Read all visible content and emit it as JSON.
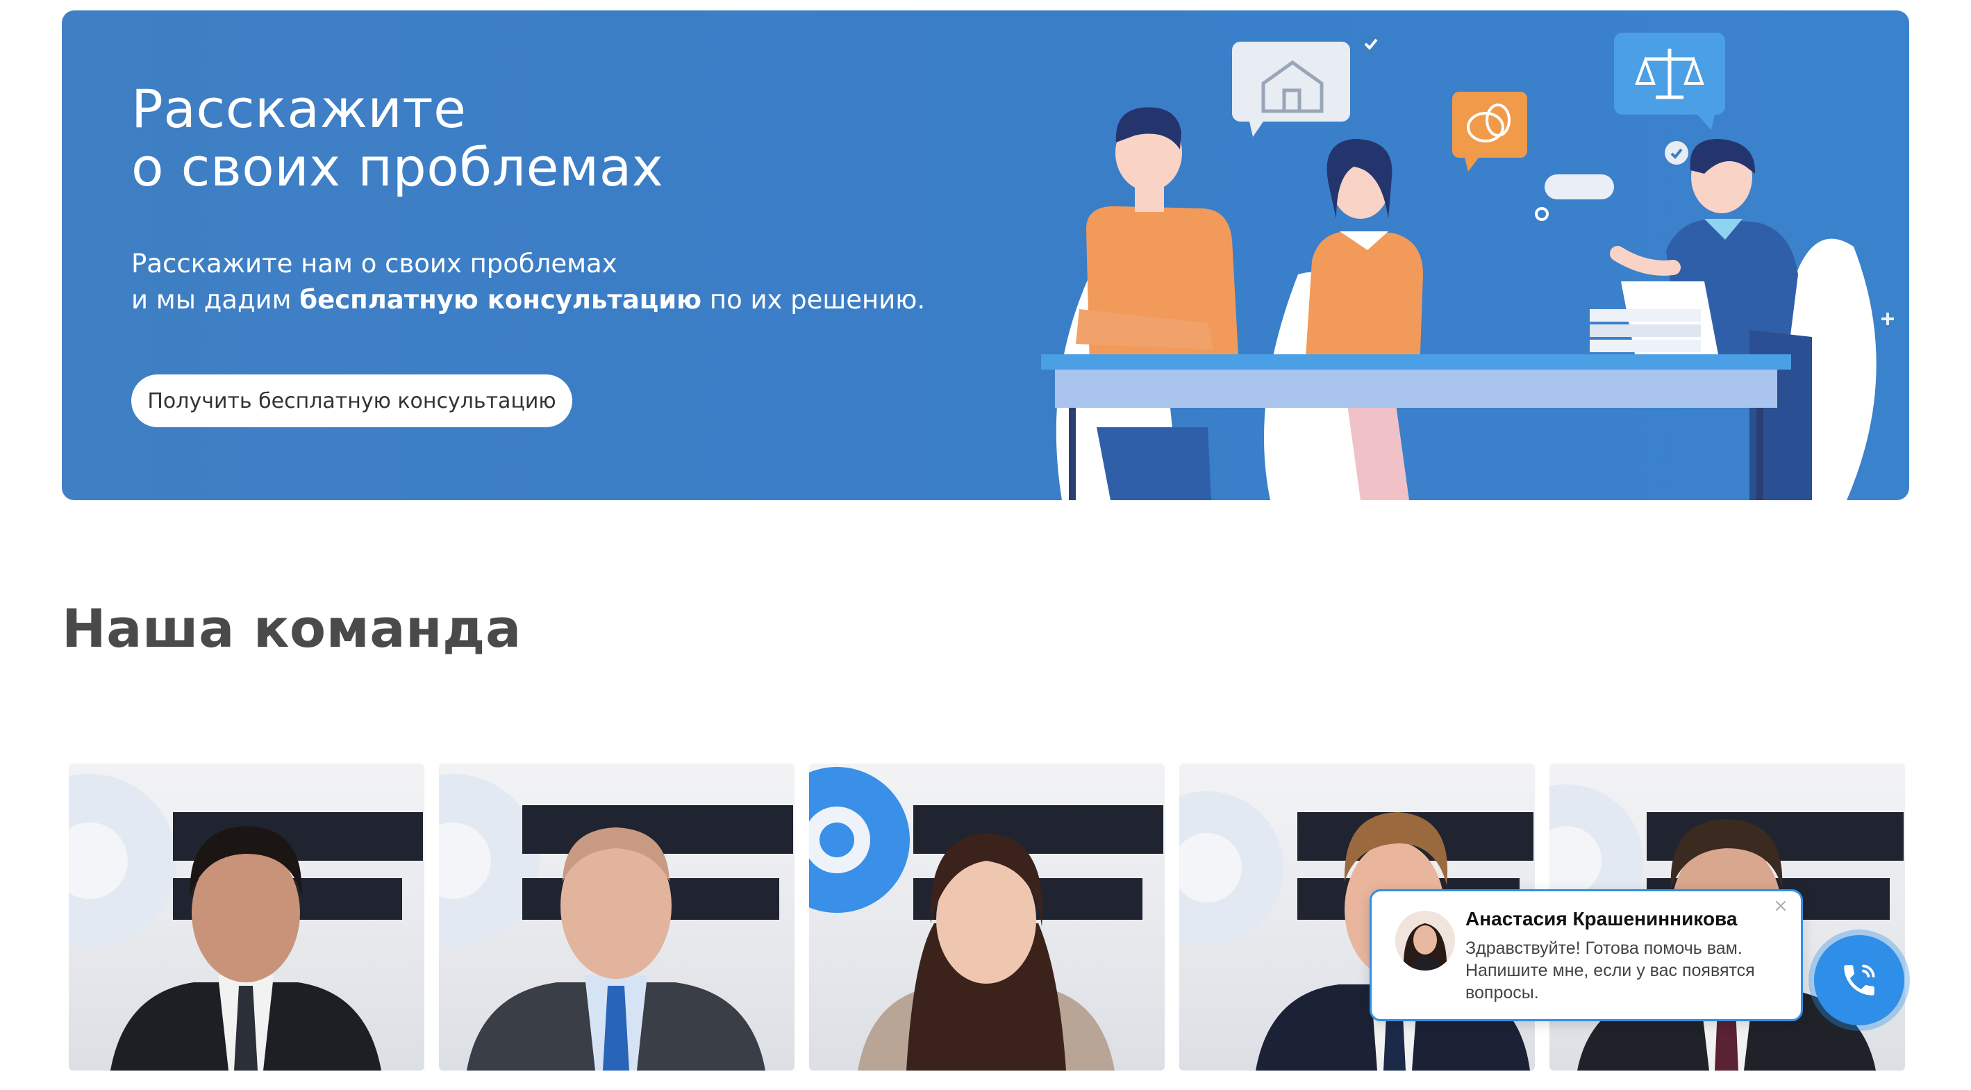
{
  "banner": {
    "title": "Расскажите\nо своих проблемах",
    "text_line1": "Расскажите нам о своих проблемах",
    "text_line2_pre": "и мы дадим ",
    "text_line2_bold": "бесплатную консультацию",
    "text_line2_post": " по их решению.",
    "cta_label": "Получить бесплатную консультацию",
    "colors": {
      "background": "#3b7fc6",
      "button": "#ffffff"
    }
  },
  "team": {
    "title": "Наша команда",
    "members": [
      {
        "photo": "team-member-photo-1"
      },
      {
        "photo": "team-member-photo-2"
      },
      {
        "photo": "team-member-photo-3"
      },
      {
        "photo": "team-member-photo-4"
      },
      {
        "photo": "team-member-photo-5"
      }
    ]
  },
  "chat": {
    "agent_name": "Анастасия Крашенинникова",
    "message": "Здравствуйте! Готова помочь вам. Напишите мне, если у вас появятся вопросы.",
    "close_label": "×",
    "call_icon": "phone-icon",
    "accent": "#2f8fe8"
  }
}
